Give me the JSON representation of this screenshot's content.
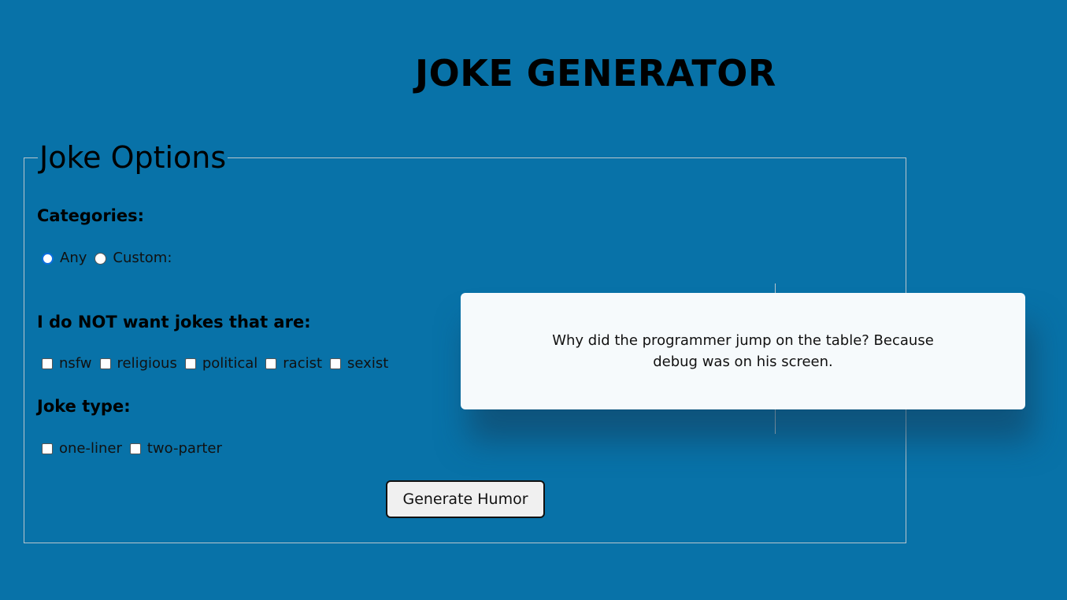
{
  "header": {
    "title": "JOKE GENERATOR"
  },
  "options": {
    "legend": "Joke Options",
    "categories": {
      "label": "Categories:",
      "choices": [
        {
          "label": "Any",
          "checked": true
        },
        {
          "label": "Custom:",
          "checked": false
        }
      ]
    },
    "blacklist": {
      "label": "I do NOT want jokes that are:",
      "flags": [
        {
          "label": "nsfw",
          "checked": false
        },
        {
          "label": "religious",
          "checked": false
        },
        {
          "label": "political",
          "checked": false
        },
        {
          "label": "racist",
          "checked": false
        },
        {
          "label": "sexist",
          "checked": false
        }
      ]
    },
    "joke_type": {
      "label": "Joke type:",
      "types": [
        {
          "label": "one-liner",
          "checked": false
        },
        {
          "label": "two-parter",
          "checked": false
        }
      ]
    },
    "generate_label": "Generate Humor"
  },
  "joke": {
    "text": "Why did the programmer jump on the table? Because debug was on his screen."
  },
  "colors": {
    "background": "#0872a8",
    "card": "#f6fafc",
    "radio_accent": "#0b6fe0"
  }
}
